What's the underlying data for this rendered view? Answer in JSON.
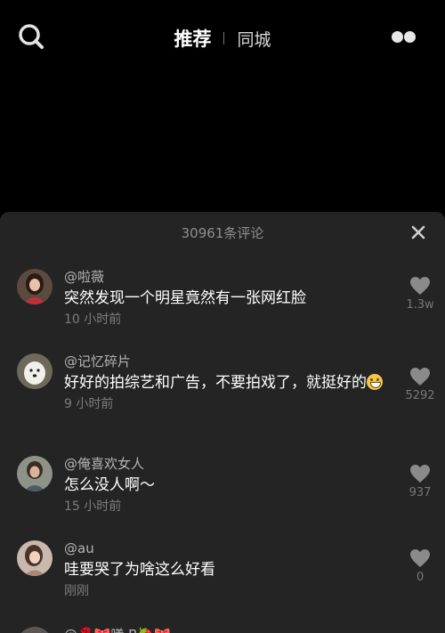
{
  "topbar": {
    "tab_recommend": "推荐",
    "tab_city": "同城"
  },
  "panel": {
    "comment_count": "30961条评论"
  },
  "comments": [
    {
      "username": "@啦薇",
      "content": "突然发现一个明星竟然有一张网红脸",
      "time": "10 小时前",
      "likes": "1.3w"
    },
    {
      "username": "@记忆碎片",
      "content": "好好的拍综艺和广告，不要拍戏了，就挺好的",
      "emoji": "grinning-emoji",
      "time": "9 小时前",
      "likes": "5292"
    },
    {
      "username": "@俺喜欢女人",
      "content": "怎么没人啊～",
      "time": "15 小时前",
      "likes": "937"
    },
    {
      "username": "@au",
      "content": "哇要哭了为啥这么好看",
      "time": "刚刚",
      "likes": "0"
    },
    {
      "username": "@🌹🎀曦·B🍓🎀"
    }
  ],
  "icons": {
    "search": "search-icon",
    "more": "more-dots-icon",
    "close": "close-icon",
    "like": "heart-icon"
  },
  "colors": {
    "background": "#000000",
    "panel": "#242424",
    "secondary_text": "#8e8e8e",
    "like_icon": "#8a8a8a"
  }
}
